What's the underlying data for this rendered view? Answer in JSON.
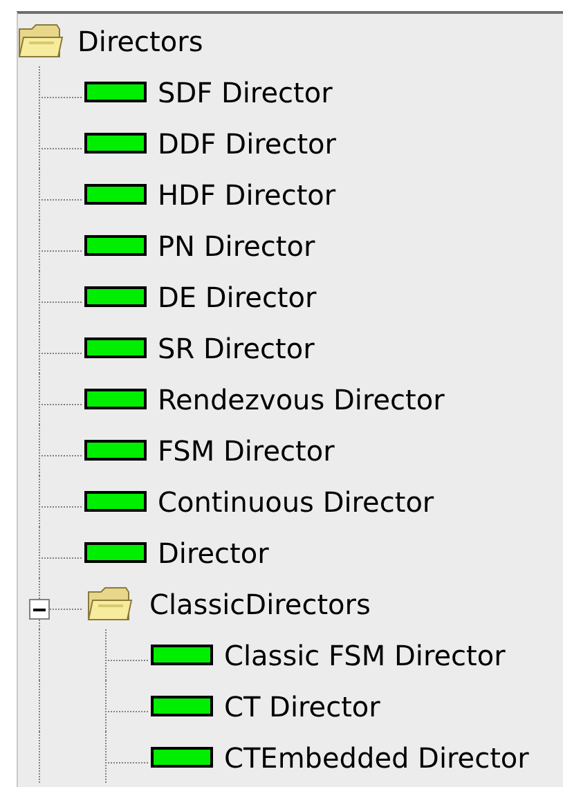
{
  "tree": [
    {
      "label": "Directors",
      "kind": "folder",
      "children": [
        {
          "label": "SDF Director",
          "kind": "director"
        },
        {
          "label": "DDF Director",
          "kind": "director"
        },
        {
          "label": "HDF Director",
          "kind": "director"
        },
        {
          "label": "PN Director",
          "kind": "director"
        },
        {
          "label": "DE Director",
          "kind": "director"
        },
        {
          "label": "SR Director",
          "kind": "director"
        },
        {
          "label": "Rendezvous Director",
          "kind": "director"
        },
        {
          "label": "FSM Director",
          "kind": "director"
        },
        {
          "label": "Continuous Director",
          "kind": "director"
        },
        {
          "label": "Director",
          "kind": "director"
        },
        {
          "label": "ClassicDirectors",
          "kind": "folder",
          "expanded": true,
          "children": [
            {
              "label": "Classic FSM Director",
              "kind": "director"
            },
            {
              "label": "CT Director",
              "kind": "director"
            },
            {
              "label": "CTEmbedded Director",
              "kind": "director"
            }
          ]
        }
      ]
    }
  ]
}
